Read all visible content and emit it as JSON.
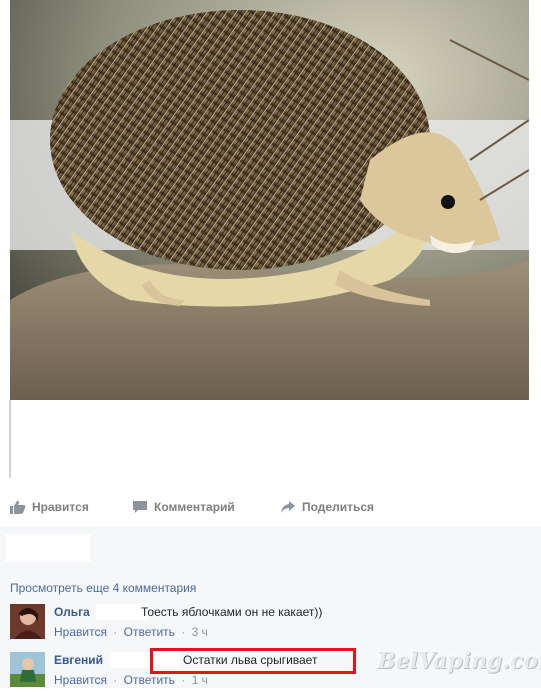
{
  "post": {
    "photo_alt": "hedgehog photo"
  },
  "actions": {
    "like": "Нравится",
    "comment": "Комментарий",
    "share": "Поделиться"
  },
  "comments": {
    "view_more": "Просмотреть еще 4 комментария",
    "items": [
      {
        "author": "Ольга",
        "text": "Тоесть яблочками он не какает))",
        "like": "Нравится",
        "reply": "Ответить",
        "time": "3 ч"
      },
      {
        "author": "Евгений",
        "text": "Остатки льва срыгивает",
        "like": "Нравится",
        "reply": "Ответить",
        "time": "1 ч"
      }
    ],
    "separator": "·"
  },
  "watermark": "BelVaping.com",
  "colors": {
    "link": "#4b6aa4",
    "author": "#365899",
    "highlight": "#e8121c",
    "comments_bg": "#f6f7f9"
  }
}
